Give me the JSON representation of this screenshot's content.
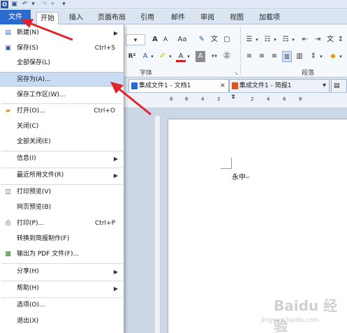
{
  "ribbon_tabs": {
    "file": "文件",
    "start": "开始",
    "insert": "插入",
    "layout": "页面布局",
    "references": "引用",
    "mail": "邮件",
    "review": "审阅",
    "view": "视图",
    "addins": "加载项"
  },
  "ribbon_groups": {
    "font": "字体",
    "paragraph": "段落"
  },
  "ribbon_glyphs": {
    "grow": "A",
    "case": "Aa",
    "superscript": "R²",
    "font_color": "A",
    "char_shade": "A"
  },
  "doc_tabs": {
    "doc1": "集成文件1 - 文档1",
    "doc2": "集成文件1 - 简报1"
  },
  "ruler": {
    "numbers": [
      "8",
      "6",
      "4",
      "2",
      "2",
      "4",
      "6",
      "8"
    ]
  },
  "document": {
    "text": "永中"
  },
  "file_menu": {
    "new": "新建(N)",
    "save": "保存(S)",
    "save_shortcut": "Ctrl+S",
    "save_all": "全部保存(L)",
    "save_as": "另存为(A)...",
    "save_workspace": "保存工作区(W)...",
    "open": "打开(O)...",
    "open_shortcut": "Ctrl+O",
    "close": "关闭(C)",
    "close_all": "全部关闭(E)",
    "info": "信息(I)",
    "recent": "最近所用文件(R)",
    "print_preview": "打印预览(V)",
    "web_preview": "网页预览(B)",
    "print": "打印(P)...",
    "print_shortcut": "Ctrl+P",
    "convert": "转换到简报制作(F)",
    "export_pdf": "输出为 PDF 文件(F)...",
    "share": "分享(H)",
    "help": "帮助(H)",
    "options": "选项(O)...",
    "exit": "退出(X)"
  },
  "watermark": {
    "text": "Baidu 经验",
    "sub": "jingyan.baidu.com"
  },
  "colors": {
    "file_tab": "#2a6bd1",
    "highlight": "#c9dcf3",
    "arrow": "#e0242b"
  }
}
